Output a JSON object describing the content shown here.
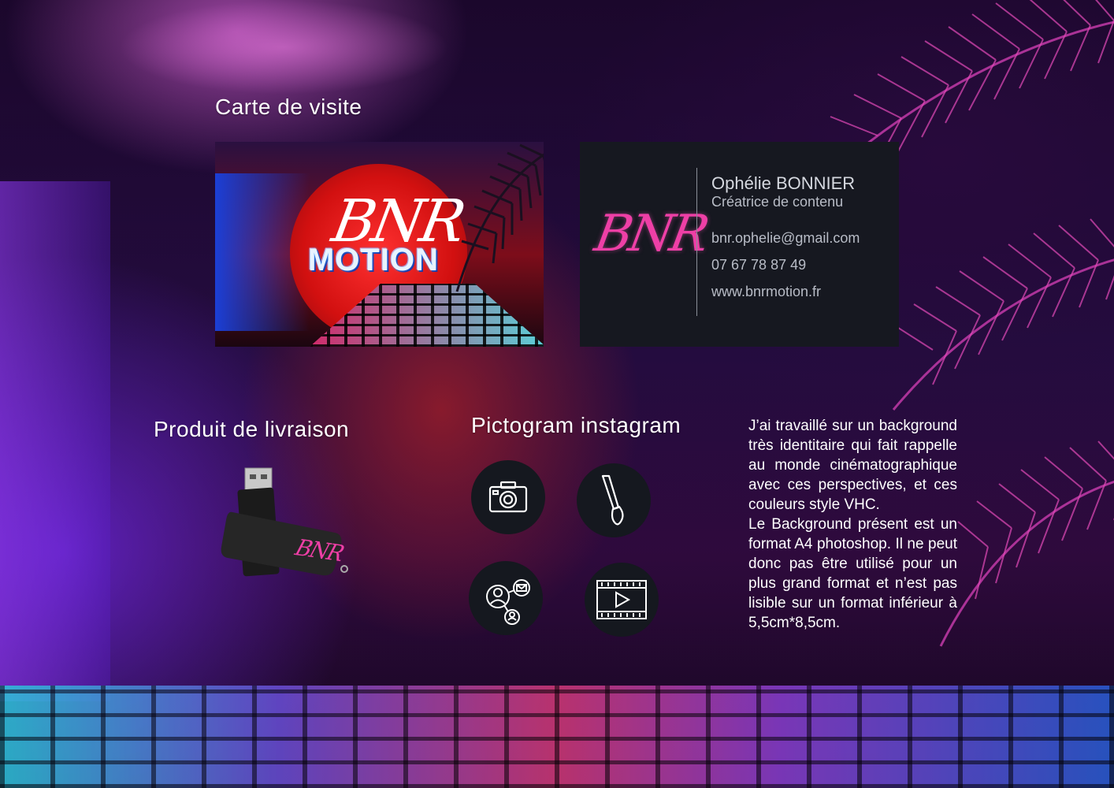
{
  "sections": {
    "business_card_title": "Carte de visite",
    "delivery_title": "Produit de livraison",
    "pictogram_title": "Pictogram instagram"
  },
  "card_front": {
    "logo_script": "BNR",
    "logo_word": "MOTION"
  },
  "card_back": {
    "logo_script": "BNR",
    "name": "Ophélie BONNIER",
    "role": "Créatrice de contenu",
    "email": "bnr.ophelie@gmail.com",
    "phone": "07 67 78 87 49",
    "website": "www.bnrmotion.fr"
  },
  "usb": {
    "logo_script": "BNR"
  },
  "pictograms": [
    {
      "icon": "camera-icon"
    },
    {
      "icon": "paintbrush-icon"
    },
    {
      "icon": "network-contacts-icon"
    },
    {
      "icon": "film-play-icon"
    }
  ],
  "description": {
    "paragraph1": "J’ai travaillé sur un background très identitaire qui fait rappelle au monde cinématographique avec ces perspectives, et ces couleurs style VHC.",
    "paragraph2": "Le Background présent est un format A4 photoshop. Il ne peut donc pas être utilisé pour un plus grand format et n’est pas lisible sur un format inférieur à 5,5cm*8,5cm."
  },
  "colors": {
    "accent_pink": "#ee3fa6",
    "card_back_bg": "#161820",
    "sun_red": "#d21010"
  }
}
